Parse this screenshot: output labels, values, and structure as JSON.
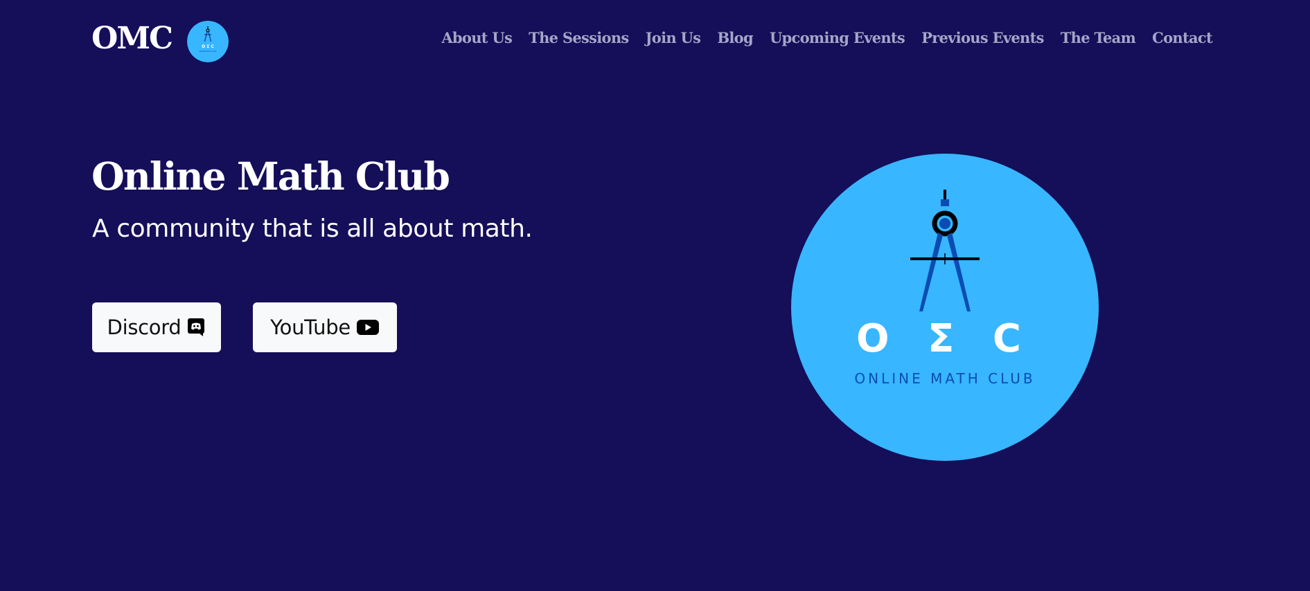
{
  "header": {
    "brand": "OMC",
    "logo_icon": "omc-compass-logo",
    "nav": [
      {
        "label": "About Us"
      },
      {
        "label": "The Sessions"
      },
      {
        "label": "Join Us"
      },
      {
        "label": "Blog"
      },
      {
        "label": "Upcoming Events"
      },
      {
        "label": "Previous Events"
      },
      {
        "label": "The Team"
      },
      {
        "label": "Contact"
      }
    ]
  },
  "hero": {
    "title": "Online Math Club",
    "subtitle": "A community that is all about math.",
    "buttons": [
      {
        "label": "Discord",
        "icon": "discord-icon"
      },
      {
        "label": "YouTube",
        "icon": "youtube-icon"
      }
    ],
    "logo": {
      "letters": "O Σ C",
      "caption": "ONLINE MATH CLUB"
    }
  },
  "colors": {
    "background": "#150e58",
    "nav_text": "#a6a5c8",
    "logo_circle": "#38b6ff",
    "logo_dark_blue": "#0b4cb3",
    "button_bg": "#f8f9fa"
  }
}
